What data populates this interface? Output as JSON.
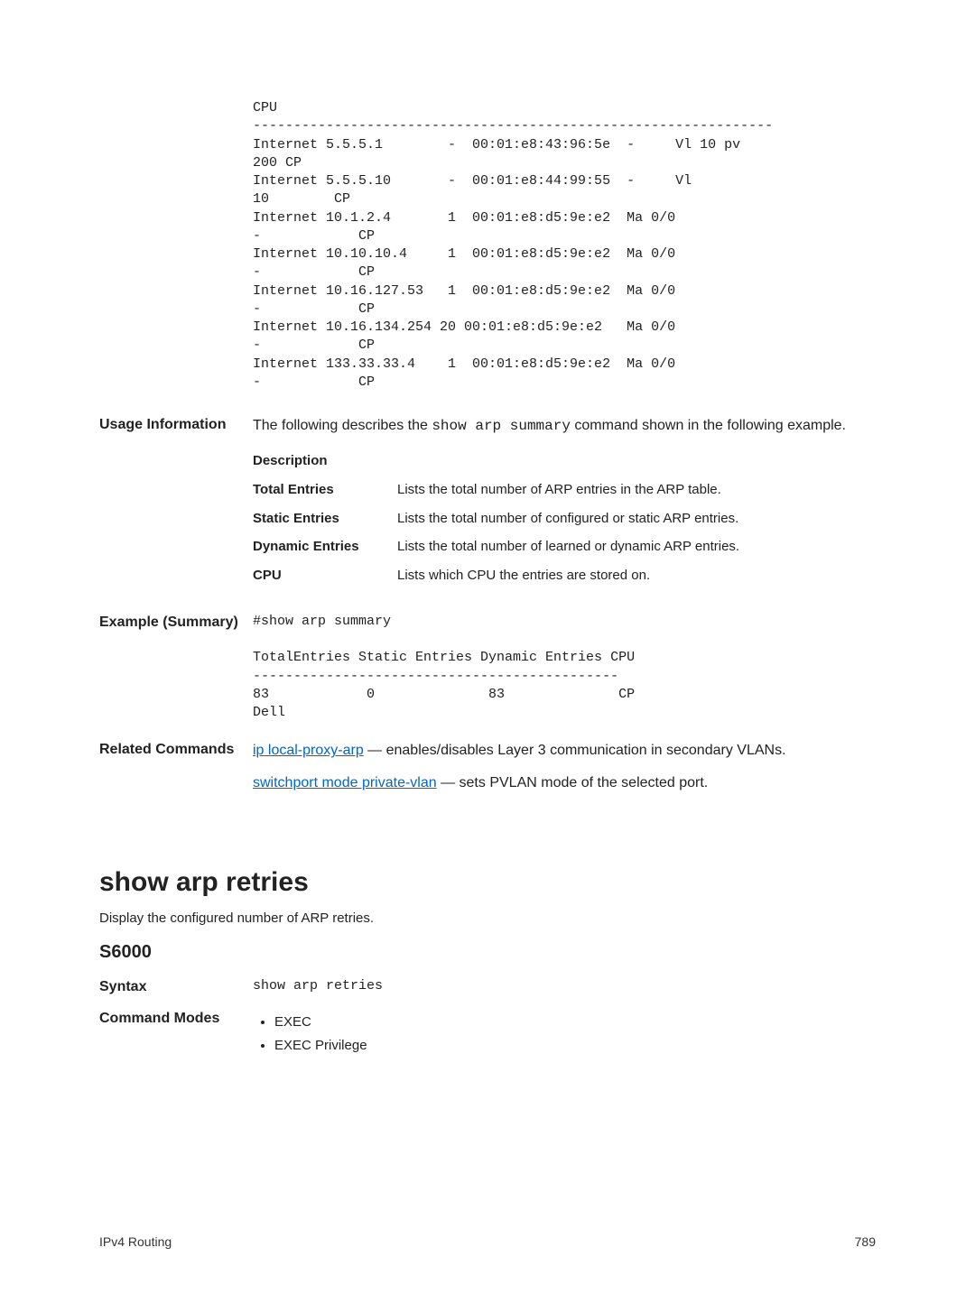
{
  "top_block": {
    "lines": [
      "CPU",
      "----------------------------------------------------------------",
      "Internet 5.5.5.1        -  00:01:e8:43:96:5e  -     Vl 10 pv",
      "200 CP",
      "Internet 5.5.5.10       -  00:01:e8:44:99:55  -     Vl",
      "10        CP",
      "Internet 10.1.2.4       1  00:01:e8:d5:9e:e2  Ma 0/0",
      "-            CP",
      "Internet 10.10.10.4     1  00:01:e8:d5:9e:e2  Ma 0/0",
      "-            CP",
      "Internet 10.16.127.53   1  00:01:e8:d5:9e:e2  Ma 0/0",
      "-            CP",
      "Internet 10.16.134.254 20 00:01:e8:d5:9e:e2   Ma 0/0",
      "-            CP",
      "Internet 133.33.33.4    1  00:01:e8:d5:9e:e2  Ma 0/0",
      "-            CP"
    ]
  },
  "usage": {
    "label": "Usage Information",
    "intro_before": "The following describes the ",
    "intro_code": "show arp summary",
    "intro_after": " command shown in the following example.",
    "description_header": "Description",
    "rows": [
      {
        "term": "Total Entries",
        "def": "Lists the total number of ARP entries in the ARP table."
      },
      {
        "term": "Static Entries",
        "def": "Lists the total number of configured or static ARP entries."
      },
      {
        "term": "Dynamic Entries",
        "def": "Lists the total number of learned or dynamic ARP entries."
      },
      {
        "term": "CPU",
        "def": "Lists which CPU the entries are stored on."
      }
    ]
  },
  "example": {
    "label": "Example (Summary)",
    "lines": [
      "#show arp summary",
      "",
      "TotalEntries Static Entries Dynamic Entries CPU",
      "---------------------------------------------",
      "83            0              83              CP",
      "Dell"
    ]
  },
  "related": {
    "label": "Related Commands",
    "items": [
      {
        "link": "ip local-proxy-arp",
        "rest": " — enables/disables Layer 3 communication in secondary VLANs."
      },
      {
        "link": "switchport mode private-vlan",
        "rest": " — sets PVLAN mode of the selected port."
      }
    ]
  },
  "section": {
    "heading": "show arp retries",
    "sub": "Display the configured number of ARP retries.",
    "model": "S6000"
  },
  "syntax": {
    "label": "Syntax",
    "value": "show arp retries"
  },
  "modes": {
    "label": "Command Modes",
    "items": [
      "EXEC",
      "EXEC Privilege"
    ]
  },
  "footer": {
    "left": "IPv4 Routing",
    "right": "789"
  }
}
